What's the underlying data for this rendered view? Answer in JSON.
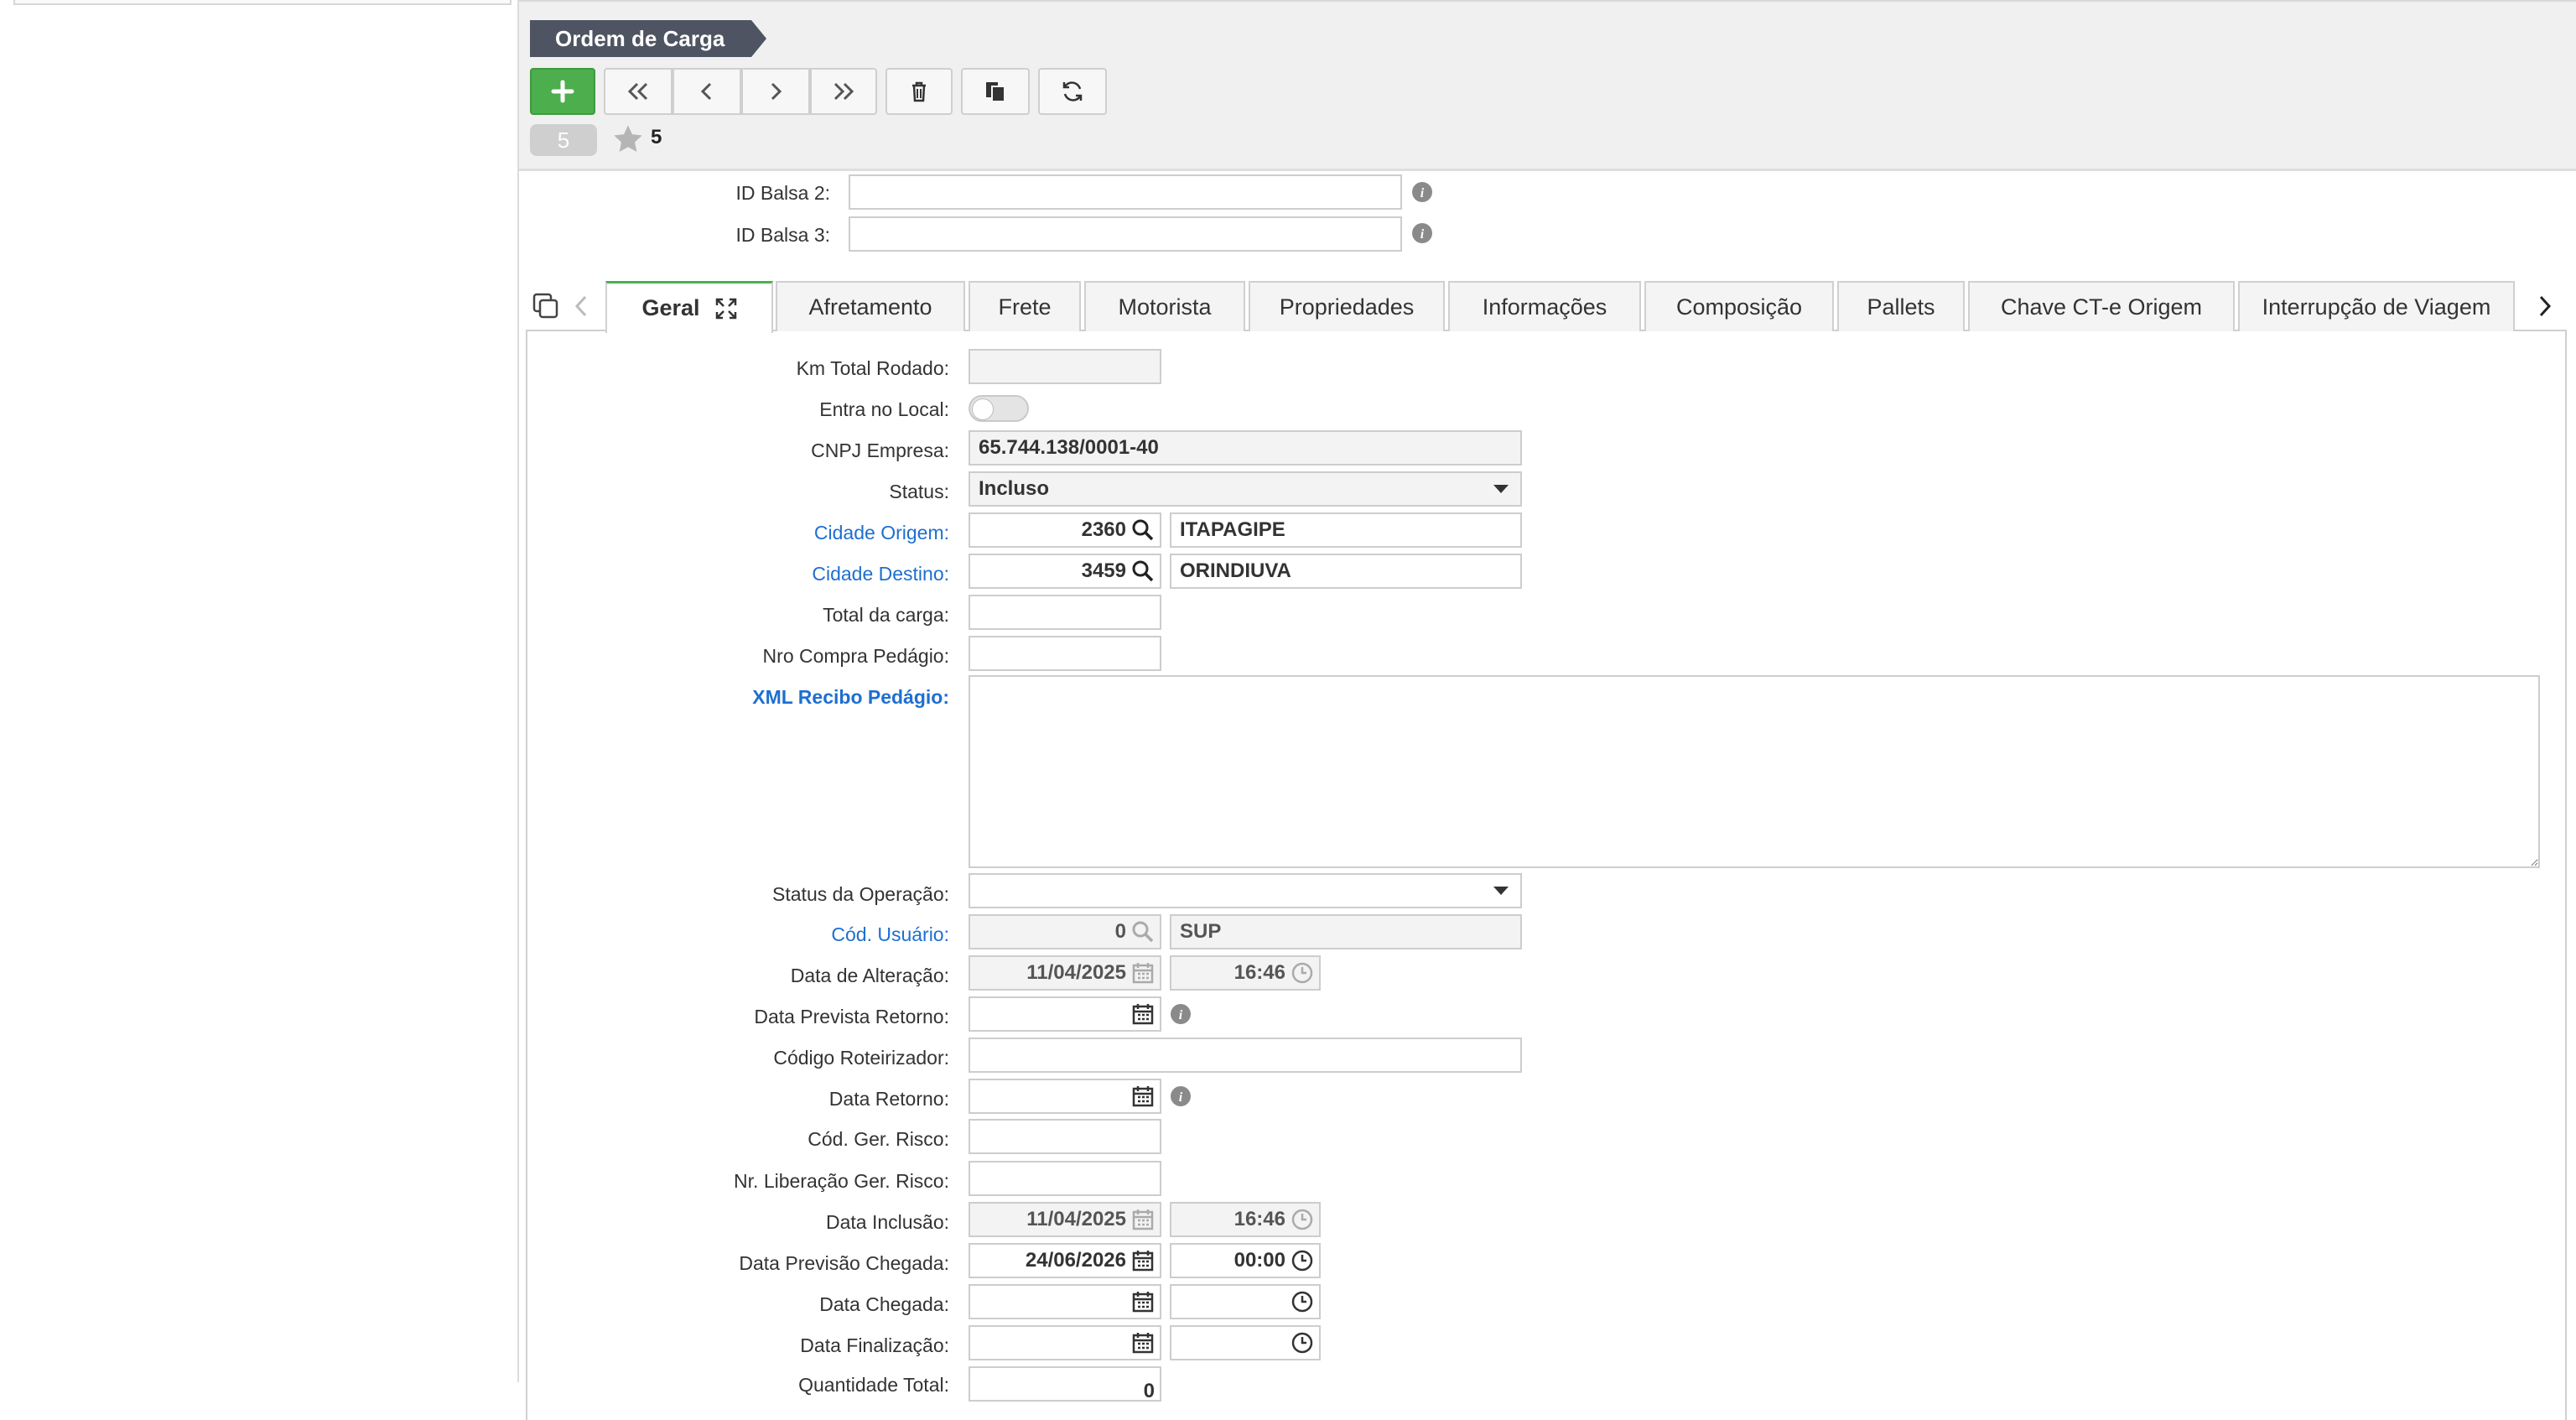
{
  "header": {
    "breadcrumb": "Ordem de Carga",
    "record_count": "5",
    "favorite_count": "5"
  },
  "fields_top": {
    "id_balsa_2_label": "ID Balsa 2:",
    "id_balsa_3_label": "ID Balsa 3:"
  },
  "tabs": [
    {
      "label": "Geral"
    },
    {
      "label": "Afretamento"
    },
    {
      "label": "Frete"
    },
    {
      "label": "Motorista"
    },
    {
      "label": "Propriedades"
    },
    {
      "label": "Informações"
    },
    {
      "label": "Composição"
    },
    {
      "label": "Pallets"
    },
    {
      "label": "Chave CT-e Origem"
    },
    {
      "label": "Interrupção de Viagem"
    }
  ],
  "form": {
    "km_total_rodado": {
      "label": "Km Total Rodado:",
      "value": ""
    },
    "entra_no_local": {
      "label": "Entra no Local:",
      "value": "off"
    },
    "cnpj_empresa": {
      "label": "CNPJ Empresa:",
      "value": "65.744.138/0001-40"
    },
    "status": {
      "label": "Status:",
      "value": "Incluso"
    },
    "cidade_origem": {
      "label": "Cidade Origem:",
      "code": "2360",
      "name": "ITAPAGIPE"
    },
    "cidade_destino": {
      "label": "Cidade Destino:",
      "code": "3459",
      "name": "ORINDIUVA"
    },
    "total_da_carga": {
      "label": "Total da carga:",
      "value": ""
    },
    "nro_compra_pedagio": {
      "label": "Nro Compra Pedágio:",
      "value": ""
    },
    "xml_recibo_pedagio": {
      "label": "XML Recibo Pedágio:",
      "value": ""
    },
    "status_operacao": {
      "label": "Status da Operação:",
      "value": ""
    },
    "cod_usuario": {
      "label": "Cód. Usuário:",
      "code": "0",
      "name": "SUP"
    },
    "data_alteracao": {
      "label": "Data de Alteração:",
      "date": "11/04/2025",
      "time": "16:46"
    },
    "data_prevista_retorno": {
      "label": "Data Prevista Retorno:",
      "date": ""
    },
    "codigo_roteirizador": {
      "label": "Código Roteirizador:",
      "value": ""
    },
    "data_retorno": {
      "label": "Data Retorno:",
      "date": ""
    },
    "cod_ger_risco": {
      "label": "Cód. Ger. Risco:",
      "value": ""
    },
    "nr_liberacao_ger_risco": {
      "label": "Nr. Liberação Ger. Risco:",
      "value": ""
    },
    "data_inclusao": {
      "label": "Data Inclusão:",
      "date": "11/04/2025",
      "time": "16:46"
    },
    "data_previsao_chegada": {
      "label": "Data Previsão Chegada:",
      "date": "24/06/2026",
      "time": "00:00"
    },
    "data_chegada": {
      "label": "Data Chegada:",
      "date": "",
      "time": ""
    },
    "data_finalizacao": {
      "label": "Data Finalização:",
      "date": "",
      "time": ""
    },
    "quantidade_total": {
      "label": "Quantidade Total:",
      "value": "0"
    }
  },
  "colors": {
    "accent_green": "#4cae4c",
    "link_blue": "#1e6fd0",
    "breadcrumb_bg": "#4e5461"
  }
}
